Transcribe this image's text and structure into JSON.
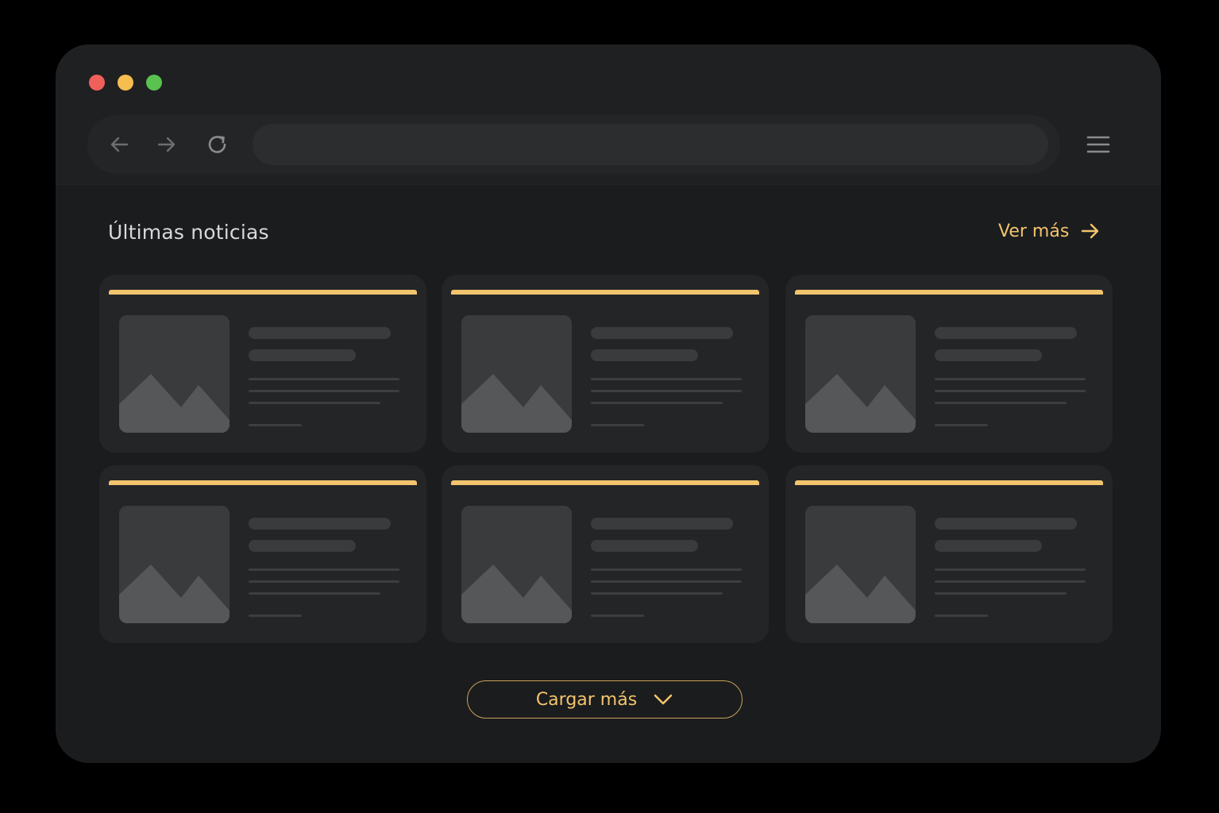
{
  "window": {
    "controls": [
      {
        "name": "close",
        "color": "#f0605a"
      },
      {
        "name": "minimize",
        "color": "#f6bd4f"
      },
      {
        "name": "maximize",
        "color": "#5ac24f"
      }
    ]
  },
  "toolbar": {
    "back_icon": "arrow-left-icon",
    "forward_icon": "arrow-right-icon",
    "reload_icon": "reload-icon",
    "url_value": "",
    "menu_icon": "hamburger-menu-icon"
  },
  "news": {
    "title": "Últimas noticias",
    "see_more_label": "Ver más",
    "accent_color": "#f2c46d",
    "cards": [
      {
        "placeholder": true
      },
      {
        "placeholder": true
      },
      {
        "placeholder": true
      },
      {
        "placeholder": true
      },
      {
        "placeholder": true
      },
      {
        "placeholder": true
      }
    ],
    "load_more_label": "Cargar más"
  }
}
